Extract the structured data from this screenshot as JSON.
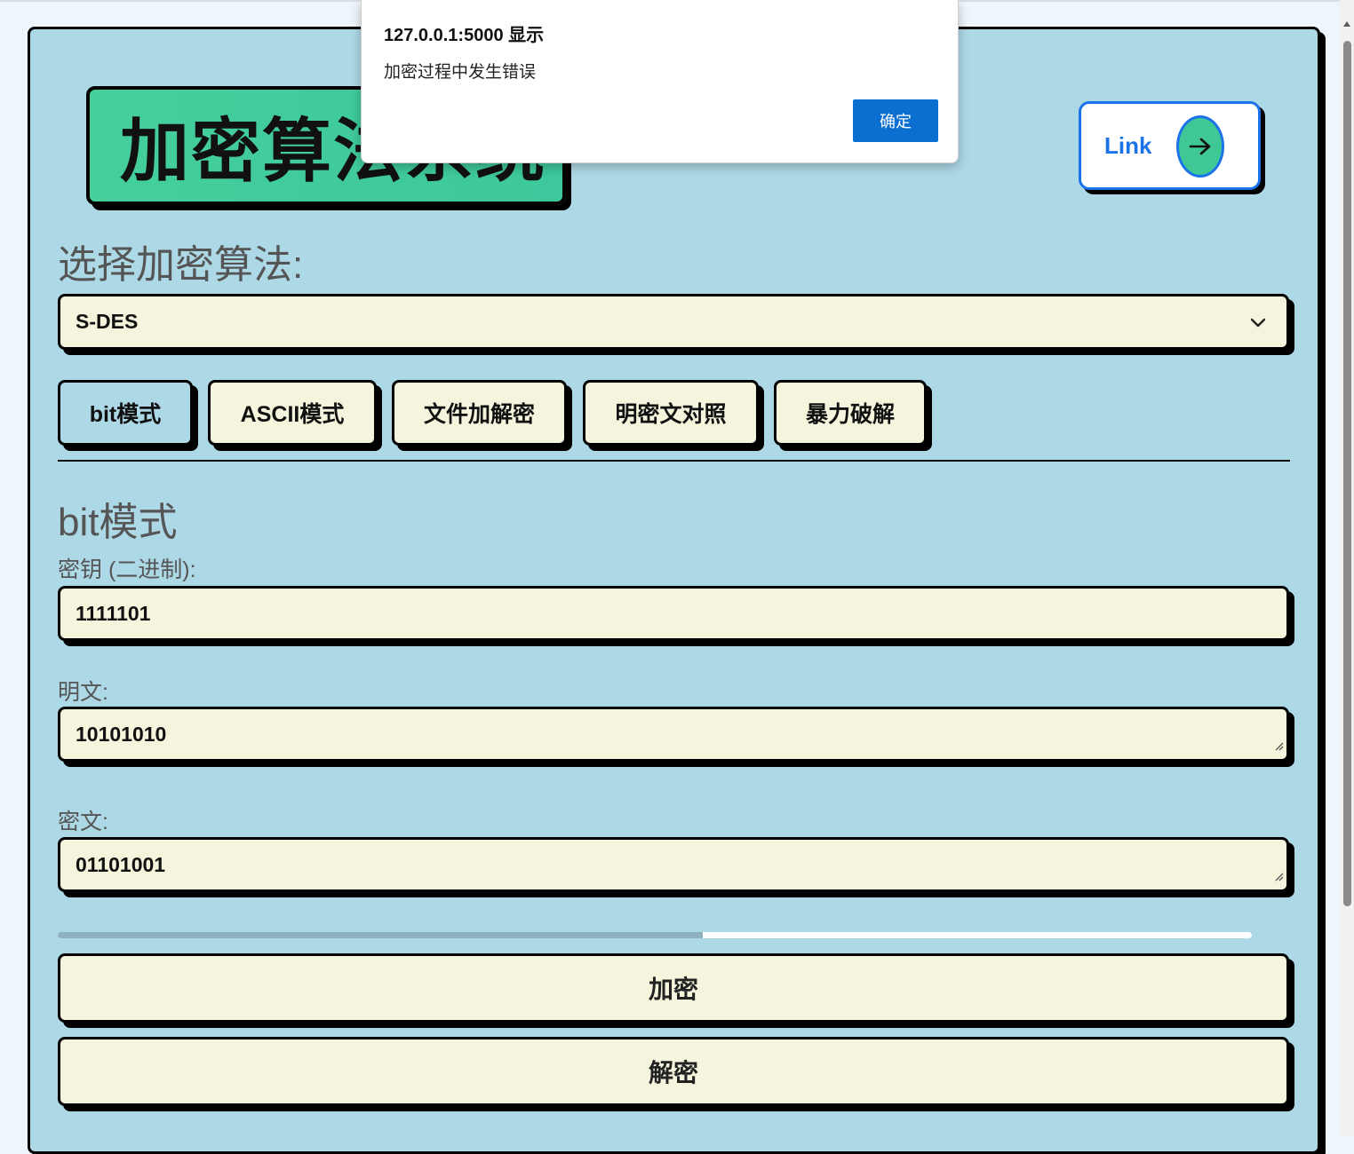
{
  "page": {
    "title": "加密算法系统",
    "link_label": "Link",
    "algorithm_section_label": "选择加密算法:",
    "algorithm_selected": "S-DES",
    "tabs": [
      {
        "label": "bit模式",
        "active": true
      },
      {
        "label": "ASCII模式",
        "active": false
      },
      {
        "label": "文件加解密",
        "active": false
      },
      {
        "label": "明密文对照",
        "active": false
      },
      {
        "label": "暴力破解",
        "active": false
      }
    ],
    "mode_heading": "bit模式",
    "key_label": "密钥 (二进制):",
    "key_value": "1111101",
    "plaintext_label": "明文:",
    "plaintext_value": "10101010",
    "ciphertext_label": "密文:",
    "ciphertext_value": "01101001",
    "progress_fraction": 0.54,
    "encrypt_label": "加密",
    "decrypt_label": "解密"
  },
  "dialog": {
    "title": "127.0.0.1:5000 显示",
    "message": "加密过程中发生错误",
    "ok_label": "确定"
  },
  "colors": {
    "card_bg": "#add8e6",
    "field_bg": "#f5f4dc",
    "title_bg": "#44cf9b",
    "link_color": "#1a73e8",
    "dialog_button": "#0a6fd1"
  },
  "icons": [
    "arrow-right-icon",
    "chevron-down-icon",
    "resize-grip-icon"
  ]
}
